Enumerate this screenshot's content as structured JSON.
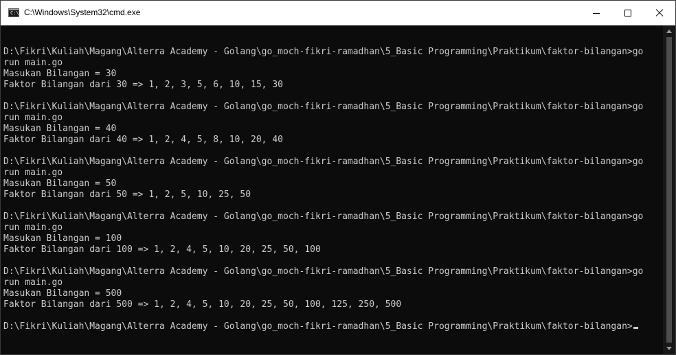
{
  "window": {
    "title": "C:\\Windows\\System32\\cmd.exe",
    "icon_text": "C:\\"
  },
  "console": {
    "lines": [
      "",
      "D:\\Fikri\\Kuliah\\Magang\\Alterra Academy - Golang\\go_moch-fikri-ramadhan\\5_Basic Programming\\Praktikum\\faktor-bilangan>go",
      "run main.go",
      "Masukan Bilangan = 30",
      "Faktor Bilangan dari 30 => 1, 2, 3, 5, 6, 10, 15, 30",
      "",
      "D:\\Fikri\\Kuliah\\Magang\\Alterra Academy - Golang\\go_moch-fikri-ramadhan\\5_Basic Programming\\Praktikum\\faktor-bilangan>go",
      "run main.go",
      "Masukan Bilangan = 40",
      "Faktor Bilangan dari 40 => 1, 2, 4, 5, 8, 10, 20, 40",
      "",
      "D:\\Fikri\\Kuliah\\Magang\\Alterra Academy - Golang\\go_moch-fikri-ramadhan\\5_Basic Programming\\Praktikum\\faktor-bilangan>go",
      "run main.go",
      "Masukan Bilangan = 50",
      "Faktor Bilangan dari 50 => 1, 2, 5, 10, 25, 50",
      "",
      "D:\\Fikri\\Kuliah\\Magang\\Alterra Academy - Golang\\go_moch-fikri-ramadhan\\5_Basic Programming\\Praktikum\\faktor-bilangan>go",
      "run main.go",
      "Masukan Bilangan = 100",
      "Faktor Bilangan dari 100 => 1, 2, 4, 5, 10, 20, 25, 50, 100",
      "",
      "D:\\Fikri\\Kuliah\\Magang\\Alterra Academy - Golang\\go_moch-fikri-ramadhan\\5_Basic Programming\\Praktikum\\faktor-bilangan>go",
      "run main.go",
      "Masukan Bilangan = 500",
      "Faktor Bilangan dari 500 => 1, 2, 4, 5, 10, 20, 25, 50, 100, 125, 250, 500",
      ""
    ],
    "prompt": "D:\\Fikri\\Kuliah\\Magang\\Alterra Academy - Golang\\go_moch-fikri-ramadhan\\5_Basic Programming\\Praktikum\\faktor-bilangan>"
  },
  "colors": {
    "titlebar_bg": "#ffffff",
    "console_bg": "#0c0c0c",
    "console_text": "#cccccc",
    "scrollbar_bg": "#171717",
    "scroll_thumb": "#4d4d4d"
  },
  "icons": {
    "app": "cmd-icon",
    "minimize": "minimize-icon",
    "maximize": "maximize-icon",
    "close": "close-icon"
  }
}
